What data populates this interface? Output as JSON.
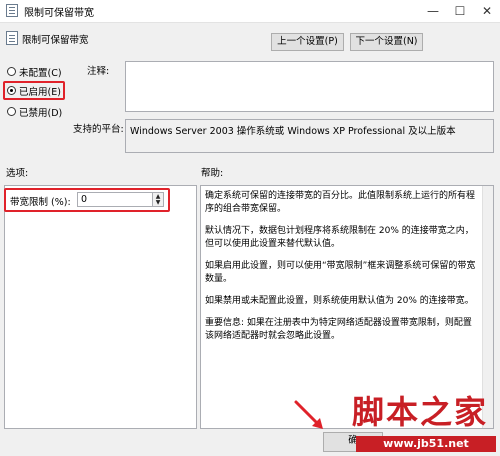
{
  "window": {
    "title": "限制可保留带宽",
    "minimize_glyph": "—",
    "maximize_glyph": "☐",
    "close_glyph": "✕"
  },
  "header": {
    "policy_name": "限制可保留带宽",
    "prev_button": "上一个设置(P)",
    "next_button": "下一个设置(N)"
  },
  "state": {
    "options": [
      {
        "label": "未配置(C)",
        "selected": false
      },
      {
        "label": "已启用(E)",
        "selected": true
      },
      {
        "label": "已禁用(D)",
        "selected": false
      }
    ]
  },
  "comment": {
    "label": "注释:",
    "value": ""
  },
  "supported": {
    "label": "支持的平台:",
    "value": "Windows Server 2003 操作系统或 Windows XP Professional 及以上版本"
  },
  "options_panel": {
    "label": "选项:",
    "bandwidth_label": "带宽限制 (%):",
    "bandwidth_value": "0"
  },
  "help_panel": {
    "label": "帮助:",
    "paragraphs": [
      "确定系统可保留的连接带宽的百分比。此值限制系统上运行的所有程序的组合带宽保留。",
      "默认情况下，数据包计划程序将系统限制在 20% 的连接带宽之内，但可以使用此设置来替代默认值。",
      "如果启用此设置，则可以使用“带宽限制”框来调整系统可保留的带宽数量。",
      "如果禁用或未配置此设置，则系统使用默认值为 20% 的连接带宽。",
      "重要信息: 如果在注册表中为特定网络适配器设置带宽限制，则配置该网络适配器时就会忽略此设置。"
    ]
  },
  "footer": {
    "ok_button_partial": "确"
  },
  "watermark": {
    "text": "脚本之家",
    "url": "www.jb51.net"
  },
  "colors": {
    "highlight": "#e0222a",
    "watermark": "#c81f25"
  }
}
